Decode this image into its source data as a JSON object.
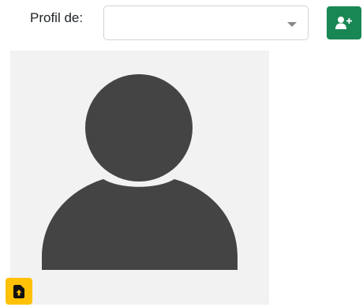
{
  "profile": {
    "label": "Profil de:",
    "selected_value": ""
  },
  "icons": {
    "add_user": "user-plus-icon",
    "avatar": "user-silhouette-icon",
    "upload": "file-upload-icon",
    "dropdown": "chevron-down-icon"
  },
  "colors": {
    "add_button": "#198754",
    "upload_button": "#ffc107",
    "avatar_background": "#f2f2f2",
    "avatar_silhouette": "#444444"
  }
}
